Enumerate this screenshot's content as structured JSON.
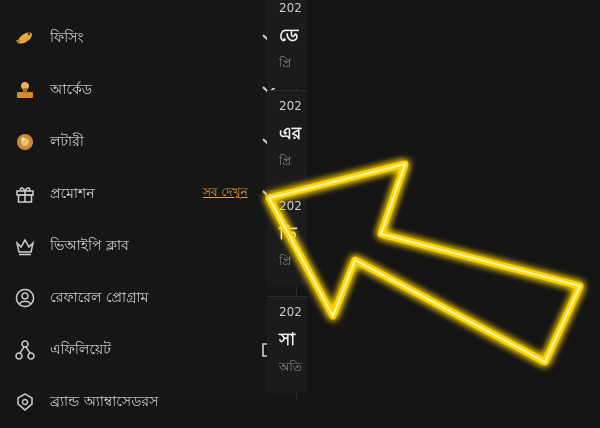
{
  "sidebar": {
    "items": [
      {
        "label": "ফিসিং",
        "icon": "fish-icon"
      },
      {
        "label": "আর্কেড",
        "icon": "arcade-icon"
      },
      {
        "label": "লটারী",
        "icon": "lottery-ball-icon"
      },
      {
        "label": "প্রমোশন",
        "icon": "gift-icon",
        "see_all": "সব দেখুন"
      },
      {
        "label": "ভিআইপি ক্লাব",
        "icon": "crown-icon"
      },
      {
        "label": "রেফারেল প্রোগ্রাম",
        "icon": "referral-icon"
      },
      {
        "label": "এফিলিয়েট",
        "icon": "affiliate-icon"
      },
      {
        "label": "ব্র্যান্ড অ্যাম্বাসেডরস",
        "icon": "ambassador-icon"
      }
    ]
  },
  "cards": [
    {
      "date": "202",
      "title": "ডে",
      "subtitle": "প্রি"
    },
    {
      "date": "202",
      "title": "এর",
      "subtitle": "প্রি"
    },
    {
      "date": "202",
      "title": "ভি",
      "subtitle": "প্রি"
    },
    {
      "date": "202",
      "title": "সা",
      "subtitle": "অতি"
    }
  ],
  "colors": {
    "accent": "#f0a030",
    "arrow": "#ffd400",
    "background": "#141414"
  }
}
